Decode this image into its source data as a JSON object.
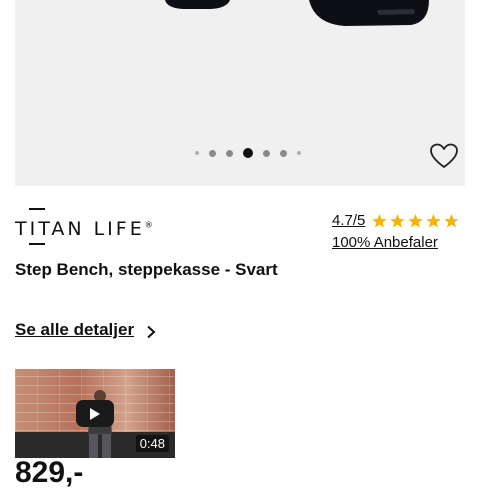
{
  "gallery": {
    "slide_count": 7,
    "active_slide": 3,
    "favorite_icon": "heart-outline-icon"
  },
  "brand": {
    "name": "TITAN LIFE",
    "registered_mark": "®"
  },
  "rating": {
    "value_text": "4.7/5",
    "stars": 4.7,
    "star_color": "#f5b400",
    "recommend_text": "100% Anbefaler"
  },
  "product": {
    "title": "Step Bench, steppekasse - Svart",
    "details_link": "Se alle detaljer",
    "price": "829,-"
  },
  "video": {
    "duration": "0:48",
    "play_icon": "play-icon"
  }
}
